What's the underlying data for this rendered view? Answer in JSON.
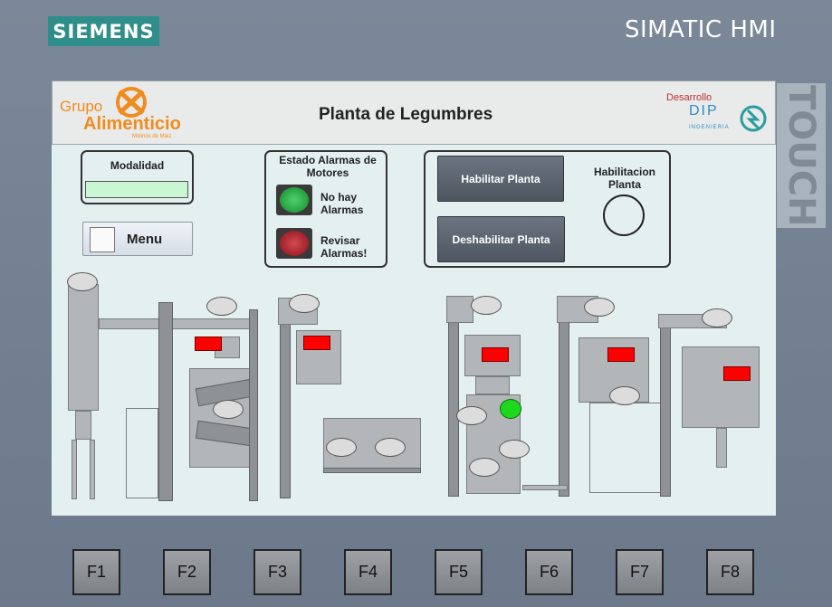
{
  "device": {
    "brand": "SIEMENS",
    "model": "SIMATIC HMI",
    "touch": "TOUCH"
  },
  "header": {
    "logo_line1": "Grupo",
    "logo_line2": "Alimenticio",
    "logo_tagline": "Molinos de Maiz",
    "title": "Planta de Legumbres",
    "dev_label": "Desarrollo",
    "dev_company": "DIP",
    "dev_sub": "INGENIERIA"
  },
  "modalidad": {
    "label": "Modalidad",
    "value": ""
  },
  "menu_button": {
    "label": "Menu"
  },
  "alarms": {
    "title": "Estado Alarmas de Motores",
    "ok_label": "No hay Alarmas",
    "check_label": "Revisar Alarmas!",
    "colors": {
      "ok": "#1aa53a",
      "alarm": "#b0121c"
    }
  },
  "plant_control": {
    "enable_label": "Habilitar Planta",
    "disable_label": "Deshabilitar Planta",
    "status_label": "Habilitacion Planta"
  },
  "colors": {
    "alarm_indicator": "#ff0000",
    "running_indicator": "#1ed81e",
    "brand": "#2f8d8a"
  },
  "function_keys": [
    "F1",
    "F2",
    "F3",
    "F4",
    "F5",
    "F6",
    "F7",
    "F8"
  ]
}
